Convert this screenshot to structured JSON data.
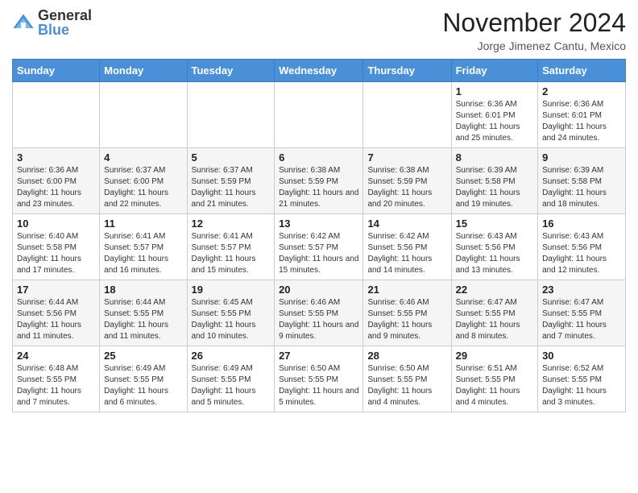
{
  "logo": {
    "text_general": "General",
    "text_blue": "Blue"
  },
  "header": {
    "month": "November 2024",
    "subtitle": "Jorge Jimenez Cantu, Mexico"
  },
  "weekdays": [
    "Sunday",
    "Monday",
    "Tuesday",
    "Wednesday",
    "Thursday",
    "Friday",
    "Saturday"
  ],
  "weeks": [
    [
      {
        "day": "",
        "info": ""
      },
      {
        "day": "",
        "info": ""
      },
      {
        "day": "",
        "info": ""
      },
      {
        "day": "",
        "info": ""
      },
      {
        "day": "",
        "info": ""
      },
      {
        "day": "1",
        "info": "Sunrise: 6:36 AM\nSunset: 6:01 PM\nDaylight: 11 hours and 25 minutes."
      },
      {
        "day": "2",
        "info": "Sunrise: 6:36 AM\nSunset: 6:01 PM\nDaylight: 11 hours and 24 minutes."
      }
    ],
    [
      {
        "day": "3",
        "info": "Sunrise: 6:36 AM\nSunset: 6:00 PM\nDaylight: 11 hours and 23 minutes."
      },
      {
        "day": "4",
        "info": "Sunrise: 6:37 AM\nSunset: 6:00 PM\nDaylight: 11 hours and 22 minutes."
      },
      {
        "day": "5",
        "info": "Sunrise: 6:37 AM\nSunset: 5:59 PM\nDaylight: 11 hours and 21 minutes."
      },
      {
        "day": "6",
        "info": "Sunrise: 6:38 AM\nSunset: 5:59 PM\nDaylight: 11 hours and 21 minutes."
      },
      {
        "day": "7",
        "info": "Sunrise: 6:38 AM\nSunset: 5:59 PM\nDaylight: 11 hours and 20 minutes."
      },
      {
        "day": "8",
        "info": "Sunrise: 6:39 AM\nSunset: 5:58 PM\nDaylight: 11 hours and 19 minutes."
      },
      {
        "day": "9",
        "info": "Sunrise: 6:39 AM\nSunset: 5:58 PM\nDaylight: 11 hours and 18 minutes."
      }
    ],
    [
      {
        "day": "10",
        "info": "Sunrise: 6:40 AM\nSunset: 5:58 PM\nDaylight: 11 hours and 17 minutes."
      },
      {
        "day": "11",
        "info": "Sunrise: 6:41 AM\nSunset: 5:57 PM\nDaylight: 11 hours and 16 minutes."
      },
      {
        "day": "12",
        "info": "Sunrise: 6:41 AM\nSunset: 5:57 PM\nDaylight: 11 hours and 15 minutes."
      },
      {
        "day": "13",
        "info": "Sunrise: 6:42 AM\nSunset: 5:57 PM\nDaylight: 11 hours and 15 minutes."
      },
      {
        "day": "14",
        "info": "Sunrise: 6:42 AM\nSunset: 5:56 PM\nDaylight: 11 hours and 14 minutes."
      },
      {
        "day": "15",
        "info": "Sunrise: 6:43 AM\nSunset: 5:56 PM\nDaylight: 11 hours and 13 minutes."
      },
      {
        "day": "16",
        "info": "Sunrise: 6:43 AM\nSunset: 5:56 PM\nDaylight: 11 hours and 12 minutes."
      }
    ],
    [
      {
        "day": "17",
        "info": "Sunrise: 6:44 AM\nSunset: 5:56 PM\nDaylight: 11 hours and 11 minutes."
      },
      {
        "day": "18",
        "info": "Sunrise: 6:44 AM\nSunset: 5:55 PM\nDaylight: 11 hours and 11 minutes."
      },
      {
        "day": "19",
        "info": "Sunrise: 6:45 AM\nSunset: 5:55 PM\nDaylight: 11 hours and 10 minutes."
      },
      {
        "day": "20",
        "info": "Sunrise: 6:46 AM\nSunset: 5:55 PM\nDaylight: 11 hours and 9 minutes."
      },
      {
        "day": "21",
        "info": "Sunrise: 6:46 AM\nSunset: 5:55 PM\nDaylight: 11 hours and 9 minutes."
      },
      {
        "day": "22",
        "info": "Sunrise: 6:47 AM\nSunset: 5:55 PM\nDaylight: 11 hours and 8 minutes."
      },
      {
        "day": "23",
        "info": "Sunrise: 6:47 AM\nSunset: 5:55 PM\nDaylight: 11 hours and 7 minutes."
      }
    ],
    [
      {
        "day": "24",
        "info": "Sunrise: 6:48 AM\nSunset: 5:55 PM\nDaylight: 11 hours and 7 minutes."
      },
      {
        "day": "25",
        "info": "Sunrise: 6:49 AM\nSunset: 5:55 PM\nDaylight: 11 hours and 6 minutes."
      },
      {
        "day": "26",
        "info": "Sunrise: 6:49 AM\nSunset: 5:55 PM\nDaylight: 11 hours and 5 minutes."
      },
      {
        "day": "27",
        "info": "Sunrise: 6:50 AM\nSunset: 5:55 PM\nDaylight: 11 hours and 5 minutes."
      },
      {
        "day": "28",
        "info": "Sunrise: 6:50 AM\nSunset: 5:55 PM\nDaylight: 11 hours and 4 minutes."
      },
      {
        "day": "29",
        "info": "Sunrise: 6:51 AM\nSunset: 5:55 PM\nDaylight: 11 hours and 4 minutes."
      },
      {
        "day": "30",
        "info": "Sunrise: 6:52 AM\nSunset: 5:55 PM\nDaylight: 11 hours and 3 minutes."
      }
    ]
  ]
}
